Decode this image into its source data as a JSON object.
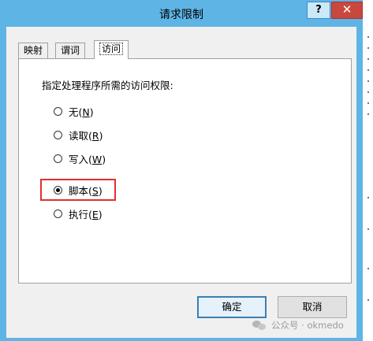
{
  "window": {
    "title": "请求限制",
    "help_label": "?",
    "close_label": "✕"
  },
  "tabs": [
    {
      "label": "映射",
      "active": false
    },
    {
      "label": "谓词",
      "active": false
    },
    {
      "label": "访问",
      "active": true
    }
  ],
  "access": {
    "instruction": "指定处理程序所需的访问权限:",
    "options": [
      {
        "label": "无(",
        "key": "N",
        "suffix": ")",
        "checked": false
      },
      {
        "label": "读取(",
        "key": "R",
        "suffix": ")",
        "checked": false
      },
      {
        "label": "写入(",
        "key": "W",
        "suffix": ")",
        "checked": false
      },
      {
        "label": "脚本(",
        "key": "S",
        "suffix": ")",
        "checked": true
      },
      {
        "label": "执行(",
        "key": "E",
        "suffix": ")",
        "checked": false
      }
    ]
  },
  "buttons": {
    "ok": "确定",
    "cancel": "取消"
  },
  "watermark": {
    "text": "公众号 · okmedo"
  },
  "colors": {
    "title_bar": "#5fb4e6",
    "close_button": "#c9483e",
    "highlight": "#e03030"
  }
}
